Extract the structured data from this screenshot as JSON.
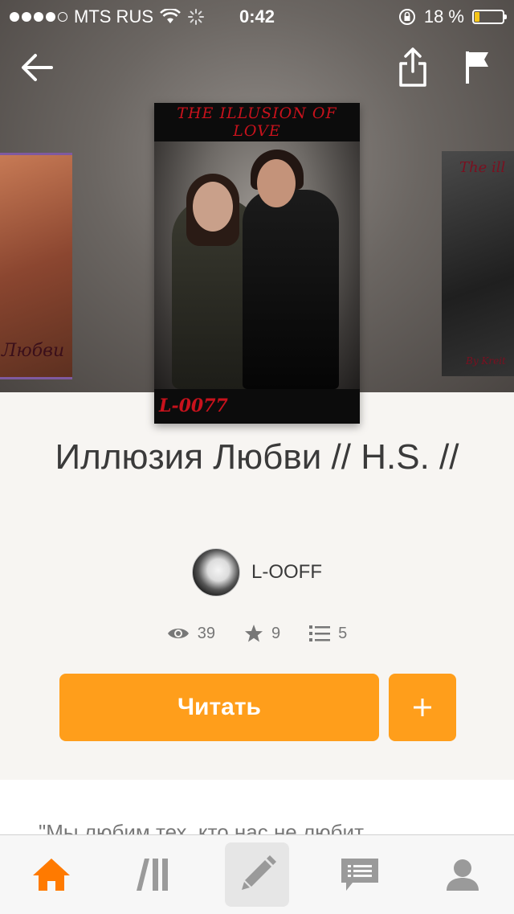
{
  "status_bar": {
    "carrier": "MTS RUS",
    "time": "0:42",
    "battery": "18 %",
    "battery_level": 0.18
  },
  "book": {
    "title": "Иллюзия Любви // H.S. //",
    "cover_title": "THE ILLUSION OF LOVE",
    "cover_author": "L-0077",
    "author": "L-OOFF",
    "reads": "39",
    "votes": "9",
    "parts": "5",
    "description_preview": "\"Мы любим тех, кто нас не любит"
  },
  "side_covers": {
    "left_text": "Любви",
    "right_text": "The ill",
    "right_text2": "By Kreit"
  },
  "actions": {
    "read_label": "Читать",
    "add_label": "+"
  },
  "colors": {
    "accent": "#ff9e1b",
    "tab_active": "#ff7a00",
    "tab_inactive": "#9a9a9a"
  },
  "icons": [
    "back-arrow-icon",
    "share-icon",
    "flag-icon",
    "eye-icon",
    "star-icon",
    "list-icon",
    "plus-icon",
    "home-icon",
    "library-icon",
    "pencil-icon",
    "message-icon",
    "profile-icon"
  ]
}
